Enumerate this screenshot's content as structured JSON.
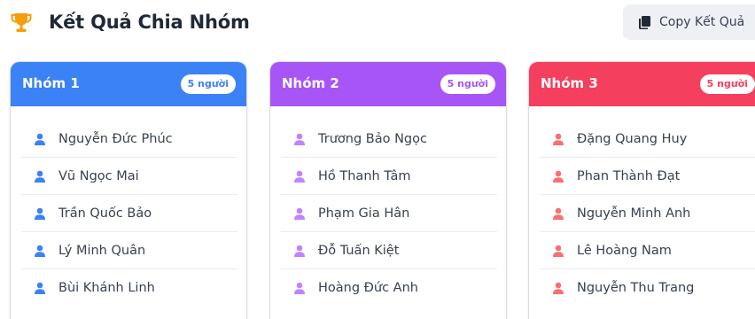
{
  "header": {
    "title": "Kết Quả Chia Nhóm",
    "trophy_icon": "trophy-icon",
    "copy_button_label": "Copy Kết Quả",
    "copy_icon": "copy-icon"
  },
  "colors": {
    "group1": "#3b82f6",
    "group2": "#a855f7",
    "group3": "#f43f5e",
    "trophy": "#f59e0b"
  },
  "groups": [
    {
      "name": "Nhóm 1",
      "count_label": "5 người",
      "members": [
        "Nguyễn Đức Phúc",
        "Vũ Ngọc Mai",
        "Trần Quốc Bảo",
        "Lý Minh Quân",
        "Bùi Khánh Linh"
      ]
    },
    {
      "name": "Nhóm 2",
      "count_label": "5 người",
      "members": [
        "Trương Bảo Ngọc",
        "Hồ Thanh Tâm",
        "Phạm Gia Hân",
        "Đỗ Tuấn Kiệt",
        "Hoàng Đức Anh"
      ]
    },
    {
      "name": "Nhóm 3",
      "count_label": "5 người",
      "members": [
        "Đặng Quang Huy",
        "Phan Thành Đạt",
        "Nguyễn Minh Anh",
        "Lê Hoàng Nam",
        "Nguyễn Thu Trang"
      ]
    }
  ]
}
